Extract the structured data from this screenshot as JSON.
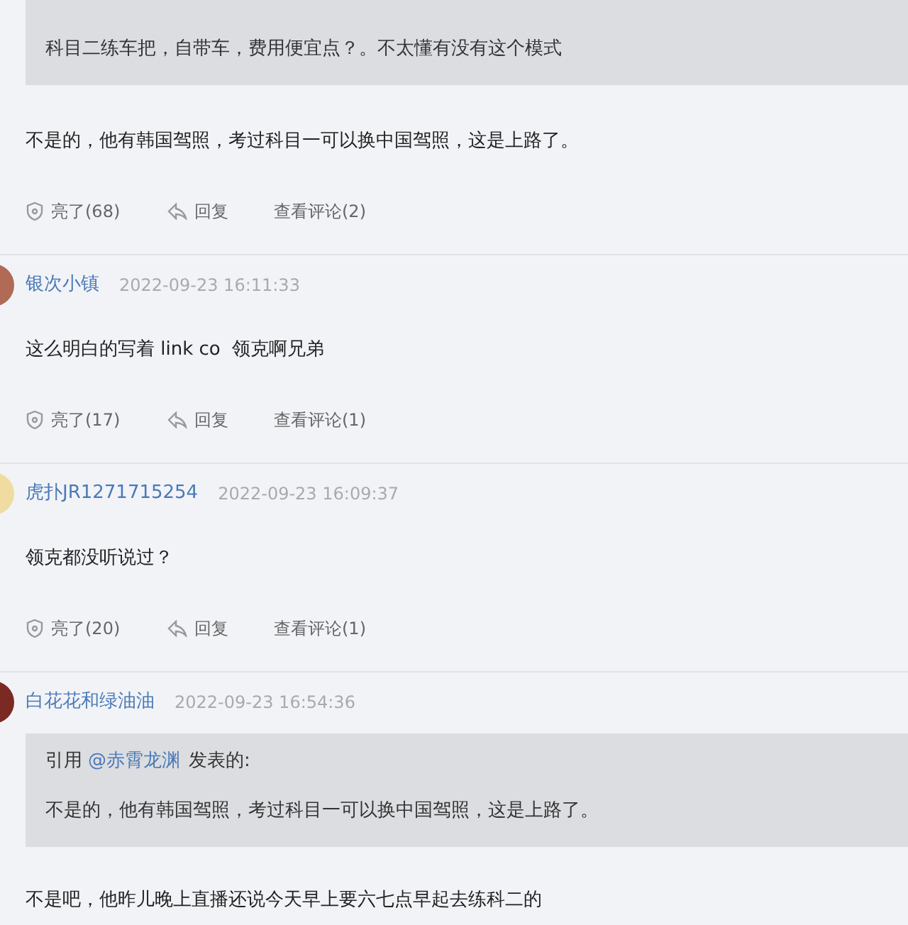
{
  "comments": [
    {
      "quote": {
        "text": "科目二练车把，自带车，费用便宜点？。不太懂有没有这个模式"
      },
      "body": "不是的，他有韩国驾照，考过科目一可以换中国驾照，这是上路了。",
      "actions": [
        {
          "kind": "like",
          "label": "亮了(68)"
        },
        {
          "kind": "reply",
          "label": "回复"
        },
        {
          "kind": "view",
          "label": "查看评论(2)"
        }
      ]
    },
    {
      "user": "银次小镇",
      "time": "2022-09-23 16:11:33",
      "color": "#b06a55",
      "body": "这么明白的写着 link co  领克啊兄弟",
      "actions": [
        {
          "kind": "like",
          "label": "亮了(17)"
        },
        {
          "kind": "reply",
          "label": "回复"
        },
        {
          "kind": "view",
          "label": "查看评论(1)"
        }
      ]
    },
    {
      "user": "虎扑JR1271715254",
      "time": "2022-09-23 16:09:37",
      "color": "#f0dca0",
      "body": "领克都没听说过？",
      "actions": [
        {
          "kind": "like",
          "label": "亮了(20)"
        },
        {
          "kind": "reply",
          "label": "回复"
        },
        {
          "kind": "view",
          "label": "查看评论(1)"
        }
      ]
    },
    {
      "user": "白花花和绿油油",
      "time": "2022-09-23 16:54:36",
      "color": "#7a2a22",
      "quote": {
        "prefix": "引用",
        "mention": "@赤霄龙渊",
        "suffix": "发表的:",
        "text": "不是的，他有韩国驾照，考过科目一可以换中国驾照，这是上路了。"
      },
      "body": "不是吧，他昨儿晚上直播还说今天早上要六七点早起去练科二的"
    }
  ]
}
